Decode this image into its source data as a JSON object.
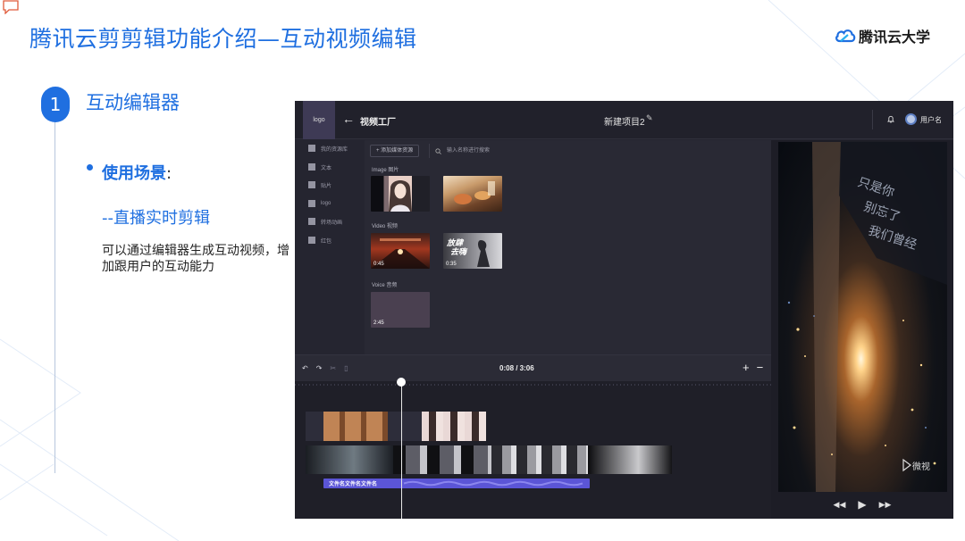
{
  "slide": {
    "title": "腾讯云剪剪辑功能介绍—互动视频编辑",
    "brand": "腾讯云大学",
    "step_number": "1",
    "step_title": "互动编辑器",
    "usage_label": "使用场景",
    "usage_colon": ":",
    "sub_title": "--直播实时剪辑",
    "description": "可以通过编辑器生成互动视频，增加跟用户的互动能力"
  },
  "editor": {
    "logo": "logo",
    "app_name": "视频工厂",
    "project_name": "新建项目2",
    "user_name": "用户名",
    "sidebar": {
      "items": [
        {
          "label": "我的资源库"
        },
        {
          "label": "文本"
        },
        {
          "label": "贴片"
        },
        {
          "label": "logo"
        },
        {
          "label": "转场动画"
        },
        {
          "label": "红包"
        }
      ]
    },
    "media": {
      "add_button": "+ 添加媒体资源",
      "search_placeholder": "输入名称进行搜索",
      "image_label": "Image 图片",
      "video_label": "Video 视频",
      "voice_label": "Voice 音频",
      "videos": [
        {
          "duration": "0:45"
        },
        {
          "duration": "0:35"
        }
      ],
      "voices": [
        {
          "duration": "2:45"
        }
      ]
    },
    "timeline": {
      "time": "0:08 / 3:06",
      "zoom_in": "+",
      "zoom_out": "−",
      "audio_clip_name": "文件名文件名文件名"
    },
    "colors": {
      "accent": "#1f6fe0",
      "audio_clip": "#5b55d6"
    }
  }
}
